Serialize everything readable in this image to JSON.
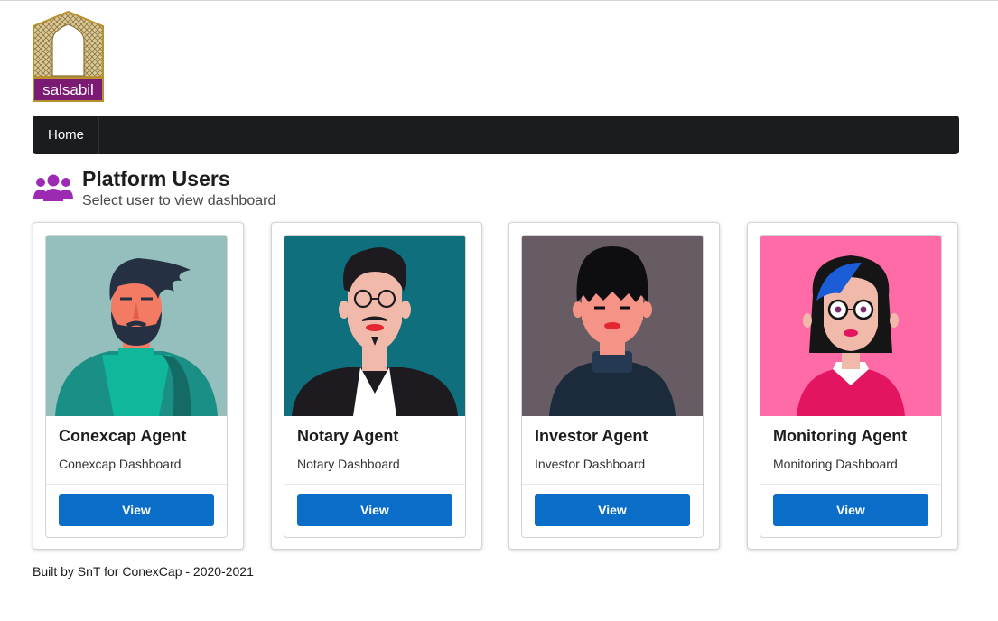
{
  "logo": {
    "wordmark": "salsabil"
  },
  "navbar": {
    "items": [
      {
        "label": "Home"
      }
    ]
  },
  "header": {
    "title": "Platform Users",
    "subtitle": "Select user to view dashboard",
    "icon": "users-icon"
  },
  "cards": [
    {
      "name": "Conexcap Agent",
      "description": "Conexcap Dashboard",
      "button": "View",
      "avatar_bg": "#94bfbd"
    },
    {
      "name": "Notary Agent",
      "description": "Notary Dashboard",
      "button": "View",
      "avatar_bg": "#0f6f7c"
    },
    {
      "name": "Investor Agent",
      "description": "Investor Dashboard",
      "button": "View",
      "avatar_bg": "#675c63"
    },
    {
      "name": "Monitoring Agent",
      "description": "Monitoring Dashboard",
      "button": "View",
      "avatar_bg": "#ff6ba6"
    }
  ],
  "footer": {
    "text": "Built by SnT for ConexCap - 2020-2021"
  },
  "colors": {
    "accent": "#0a6ec9",
    "navbar": "#1b1c1d",
    "icon": "#9c2ab3",
    "brand_purple": "#7a1a73",
    "brand_gold": "#b8912e"
  }
}
